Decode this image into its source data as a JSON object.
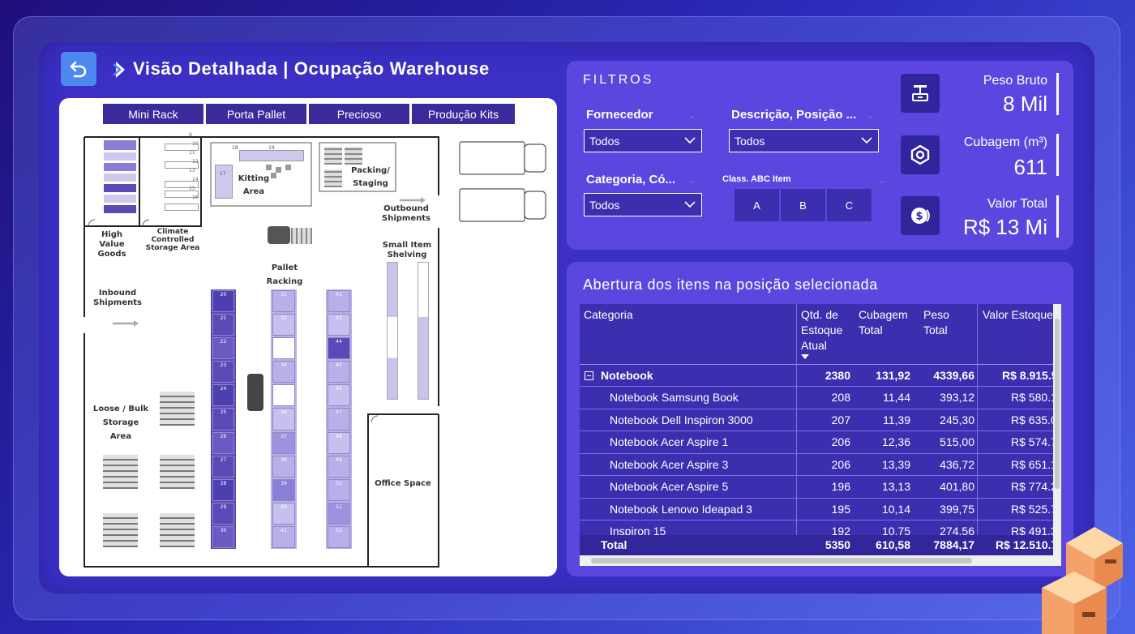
{
  "header": {
    "title": "Visão Detalhada | Ocupação Warehouse"
  },
  "floor_plan": {
    "legend_tabs": [
      "Mini Rack",
      "Porta Pallet",
      "Precioso",
      "Produção Kits"
    ],
    "labels": {
      "high_value_goods": "High Value Goods",
      "climate_controlled": "Climate Controlled Storage Area",
      "kitting_area": "Kitting Area",
      "packing_staging": "Packing/ Staging",
      "outbound_shipments": "Outbound Shipments",
      "small_item_shelving": "Small Item Shelving",
      "pallet_racking": "Pallet Racking",
      "inbound_shipments": "Inbound Shipments",
      "loose_bulk_storage": "Loose / Bulk Storage Area",
      "office_space": "Office Space"
    },
    "rack_a_numbers": [
      "20",
      "21",
      "22",
      "23",
      "24",
      "25",
      "26",
      "27",
      "28",
      "29",
      "30"
    ],
    "rack_b_numbers": [
      "31",
      "32",
      "33",
      "34",
      "35",
      "36",
      "37",
      "38",
      "39",
      "40",
      "41"
    ],
    "rack_c_numbers": [
      "42",
      "43",
      "44",
      "45",
      "46",
      "47",
      "48",
      "49",
      "50",
      "51",
      "52"
    ],
    "kitting_numbers": [
      "18",
      "19",
      "17"
    ],
    "climate_numbers": [
      "9",
      "10",
      "11",
      "12",
      "13",
      "14",
      "15",
      "16"
    ]
  },
  "filters": {
    "title": "FILTROS",
    "fornecedor": {
      "label": "Fornecedor",
      "value": "Todos"
    },
    "descricao": {
      "label": "Descrição, Posição ...",
      "value": "Todos"
    },
    "categoria": {
      "label": "Categoria, Có...",
      "value": "Todos"
    },
    "abc": {
      "label": "Class. ABC Item",
      "options": [
        "A",
        "B",
        "C"
      ]
    }
  },
  "kpis": {
    "peso": {
      "label": "Peso Bruto",
      "value": "8 Mil"
    },
    "cubagem": {
      "label": "Cubagem (m³)",
      "value": "611"
    },
    "valor": {
      "label": "Valor Total",
      "value": "R$ 13 Mi"
    }
  },
  "table": {
    "title": "Abertura dos itens na posição selecionada",
    "headers": {
      "categoria": "Categoria",
      "qtd": "Qtd. de Estoque Atual",
      "cubagem": "Cubagem Total",
      "peso": "Peso Total",
      "valor": "Valor Estoque"
    },
    "group": {
      "name": "Notebook",
      "qtd": "2380",
      "cubagem": "131,92",
      "peso": "4339,66",
      "valor": "R$ 8.915.5"
    },
    "rows": [
      {
        "name": "Notebook Samsung Book",
        "qtd": "208",
        "cubagem": "11,44",
        "peso": "393,12",
        "valor": "R$ 580.1"
      },
      {
        "name": "Notebook Dell Inspiron 3000",
        "qtd": "207",
        "cubagem": "11,39",
        "peso": "245,30",
        "valor": "R$ 635.0"
      },
      {
        "name": "Notebook Acer Aspire 1",
        "qtd": "206",
        "cubagem": "12,36",
        "peso": "515,00",
        "valor": "R$ 574.7"
      },
      {
        "name": "Notebook Acer Aspire 3",
        "qtd": "206",
        "cubagem": "13,39",
        "peso": "436,72",
        "valor": "R$ 651.1"
      },
      {
        "name": "Notebook Acer Aspire 5",
        "qtd": "196",
        "cubagem": "13,13",
        "peso": "401,80",
        "valor": "R$ 774.2"
      },
      {
        "name": "Notebook Lenovo Ideapad 3",
        "qtd": "195",
        "cubagem": "10,14",
        "peso": "399,75",
        "valor": "R$ 525.7"
      },
      {
        "name": "Inspiron 15",
        "qtd": "192",
        "cubagem": "10,75",
        "peso": "274,56",
        "valor": "R$ 491.3"
      }
    ],
    "total": {
      "label": "Total",
      "qtd": "5350",
      "cubagem": "610,58",
      "peso": "7884,17",
      "valor": "R$ 12.510.7"
    }
  },
  "colors": {
    "panel": "#5b47e0",
    "panel_dark": "#3b2fb0",
    "accent_blue": "#4d87f0",
    "rack_dark": "#5a4ab8",
    "rack_light": "#b8b0e8"
  }
}
